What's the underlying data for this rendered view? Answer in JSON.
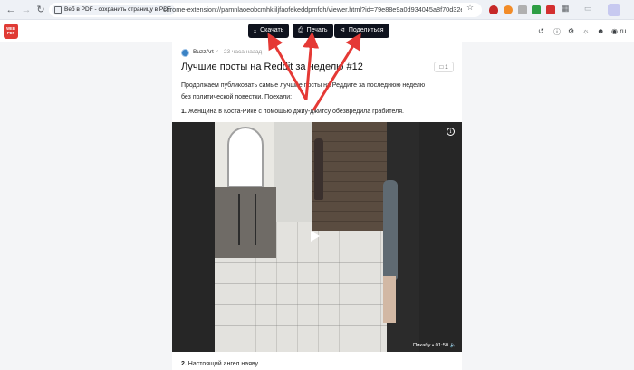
{
  "browser": {
    "extension_chip": "Веб в PDF - сохранить страницу в PDF",
    "url": "chrome-extension://pamnlaoeobcmhkliljfaofekeddpmfoh/viewer.html?id=79e88e9a0d934045a8f70d32e56..."
  },
  "app": {
    "logo_line1": "WEB",
    "logo_line2": "TO",
    "logo_line3": "PDF",
    "buttons": {
      "download": "Скачать",
      "print": "Печать",
      "share": "Поделиться"
    },
    "language": "ru"
  },
  "post": {
    "author": "BuzzArt",
    "time_ago": "23 часа назад",
    "title": "Лучшие посты на Reddit за неделю #12",
    "comments_count": "1",
    "lead": "Продолжаем публиковать самые лучшие посты на Реддите за последнюю неделю без политической повестки. Поехали:",
    "item1_num": "1.",
    "item1_text": "Женщина в Коста-Рике с помощью джиу-джитсу обезвредила грабителя.",
    "video_meta": "Пикабу • 01:50",
    "item2_num": "2.",
    "item2_text": "Настоящий ангел наяву"
  },
  "colors": {
    "brand_red": "#e03b35",
    "annotation_red": "#e53935",
    "button_dark": "#0e121d"
  },
  "icons": [
    "back-icon",
    "forward-icon",
    "reload-icon",
    "star-icon",
    "download-icon",
    "print-icon",
    "share-icon",
    "history-icon",
    "help-icon",
    "settings-icon",
    "theme-icon",
    "user-icon",
    "globe-icon",
    "play-icon",
    "info-icon",
    "volume-icon"
  ]
}
